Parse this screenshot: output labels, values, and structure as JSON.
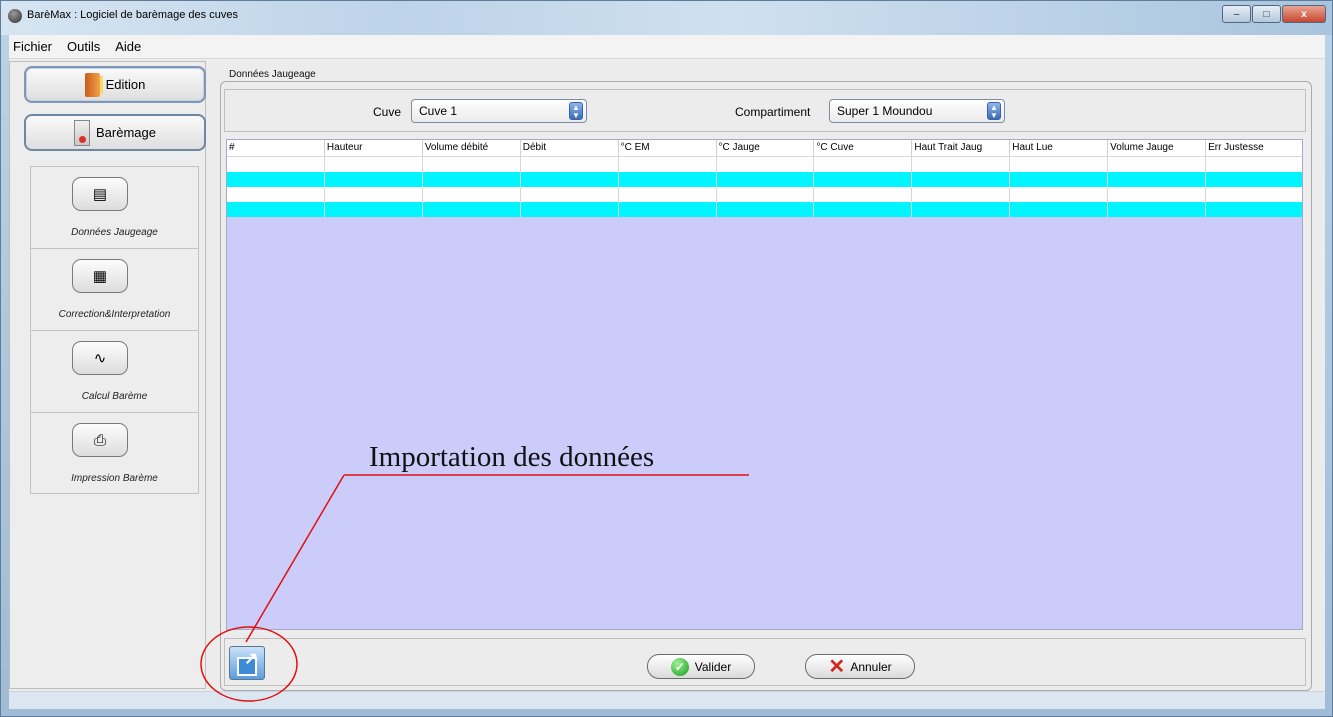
{
  "window": {
    "title": "BarèMax : Logiciel de barèmage des cuves",
    "controls": [
      "–",
      "□",
      "x"
    ]
  },
  "menu": [
    "Fichier",
    "Outils",
    "Aide"
  ],
  "sidebar": {
    "top_buttons": [
      {
        "label": "Edition",
        "icon": "book-icon"
      },
      {
        "label": "Barèmage",
        "icon": "chart-icon"
      }
    ],
    "tools": [
      {
        "label": "Données Jaugeage",
        "icon": "document-icon"
      },
      {
        "label": "Correction&Interpretation",
        "icon": "calendar-grid-icon"
      },
      {
        "label": "Calcul Barème",
        "icon": "waveform-icon"
      },
      {
        "label": "Impression Barème",
        "icon": "printer-icon"
      }
    ]
  },
  "main": {
    "panel_title": "Données Jaugeage",
    "cuve_label": "Cuve",
    "cuve_value": "Cuve 1",
    "compartiment_label": "Compartiment",
    "compartiment_value": "Super 1 Moundou"
  },
  "table": {
    "columns": [
      "#",
      "Hauteur",
      "Volume débité",
      "Débit",
      "°C EM",
      "°C Jauge",
      "°C Cuve",
      "Haut Trait Jaug",
      "Haut Lue",
      "Volume Jauge",
      "Err Justesse"
    ],
    "row_colors": [
      "#ffffff",
      "#00f5ff",
      "#ffffff",
      "#00f5ff"
    ]
  },
  "actions": {
    "import_annotation": "Importation des données",
    "validate_label": "Valider",
    "cancel_label": "Annuler"
  },
  "colors": {
    "table_background": "#ccccfa",
    "row_highlight": "#00f5ff",
    "annotation_line": "#e01010"
  }
}
